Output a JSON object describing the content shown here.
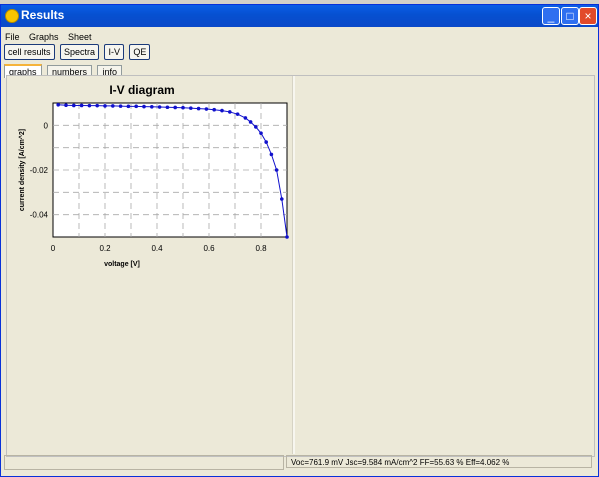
{
  "window": {
    "title": "Results",
    "minimize_icon": "minimize-icon",
    "maximize_icon": "maximize-icon",
    "close_icon": "close-icon"
  },
  "menu": [
    "File",
    "Graphs",
    "Sheet"
  ],
  "toolbar": [
    "cell results",
    "Spectra",
    "I-V",
    "QE"
  ],
  "tabs": [
    "graphs",
    "numbers",
    "info"
  ],
  "status": "Voc=761.9 mV  Jsc=9.584 mA/cm^2  FF=55.63 %  Eff=4.062 %",
  "colors": {
    "series": "#1010cc",
    "title_bar": "#0a5de6"
  },
  "chart_data": {
    "type": "line",
    "title": "I-V diagram",
    "xlabel": "voltage [V]",
    "ylabel": "current density [A/cm^2]",
    "xlim": [
      0,
      0.9
    ],
    "ylim": [
      -0.05,
      0.01
    ],
    "xticks": [
      "0",
      "0.2",
      "0.4",
      "0.6",
      "0.8"
    ],
    "yticks": [
      "0",
      "-0.02",
      "-0.04"
    ],
    "grid": true,
    "series": [
      {
        "x": [
          0.02,
          0.05,
          0.08,
          0.11,
          0.14,
          0.17,
          0.2,
          0.23,
          0.26,
          0.29,
          0.32,
          0.35,
          0.38,
          0.41,
          0.44,
          0.47,
          0.5,
          0.53,
          0.56,
          0.59,
          0.62,
          0.65,
          0.68,
          0.71,
          0.74,
          0.76,
          0.78,
          0.8,
          0.82,
          0.84,
          0.86,
          0.88,
          0.9
        ],
        "y": [
          0.0092,
          0.009,
          0.0089,
          0.0089,
          0.0088,
          0.0088,
          0.0087,
          0.0087,
          0.0086,
          0.0085,
          0.0085,
          0.0084,
          0.0083,
          0.0082,
          0.0081,
          0.008,
          0.0079,
          0.0077,
          0.0075,
          0.0073,
          0.007,
          0.0066,
          0.006,
          0.005,
          0.0033,
          0.0015,
          -0.0007,
          -0.0035,
          -0.0075,
          -0.013,
          -0.02,
          -0.033,
          -0.05
        ]
      }
    ]
  }
}
